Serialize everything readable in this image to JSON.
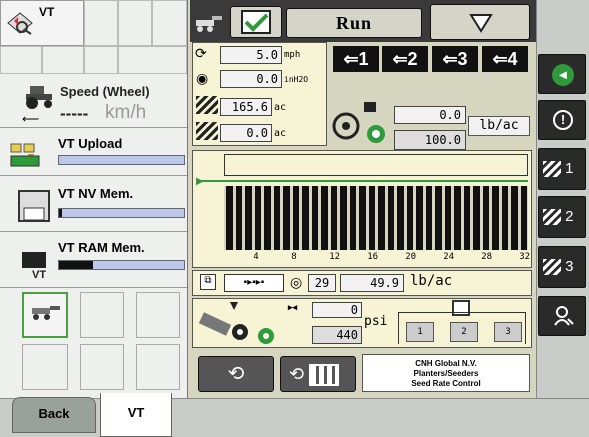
{
  "left_panel": {
    "vt_title": "VT",
    "speed": {
      "label": "Speed (Wheel)",
      "value": "-----",
      "unit": "km/h"
    },
    "upload": {
      "label": "VT Upload",
      "progress": 0
    },
    "nv_mem": {
      "label": "VT NV Mem.",
      "progress": 0.02
    },
    "ram_mem": {
      "label": "VT RAM Mem.",
      "progress": 0.27
    }
  },
  "tabs": {
    "back": "Back",
    "vt": "VT"
  },
  "top_bar": {
    "mode": "Run"
  },
  "stats": {
    "speed": {
      "value": "5.0",
      "unit": "mph"
    },
    "vacuum": {
      "value": "0.0",
      "unit": "inH2O"
    },
    "area1": {
      "value": "165.6",
      "unit": "ac"
    },
    "area2": {
      "value": "0.0",
      "unit": "ac"
    }
  },
  "sections": [
    "1",
    "2",
    "3",
    "4"
  ],
  "rate": {
    "actual": "0.0",
    "target": "100.0",
    "unit": "lb/ac"
  },
  "row_axis": [
    "4",
    "8",
    "12",
    "16",
    "20",
    "24",
    "28",
    "32"
  ],
  "row_count": 32,
  "bottom_rate": {
    "rows": "29",
    "value": "49.9",
    "unit": "lb/ac"
  },
  "pressure": {
    "value": "0",
    "target": "440",
    "unit": "psi",
    "buttons": [
      "1",
      "2",
      "3"
    ]
  },
  "company": {
    "line1": "CNH Global N.V.",
    "line2": "Planters/Seeders",
    "line3": "Seed Rate Control"
  },
  "right_buttons": [
    "1",
    "2",
    "3"
  ],
  "colors": {
    "panel": "#d6d6c0",
    "display": "#f6f4d4",
    "green": "#2e9a3a",
    "dark": "#2a2a2a"
  }
}
